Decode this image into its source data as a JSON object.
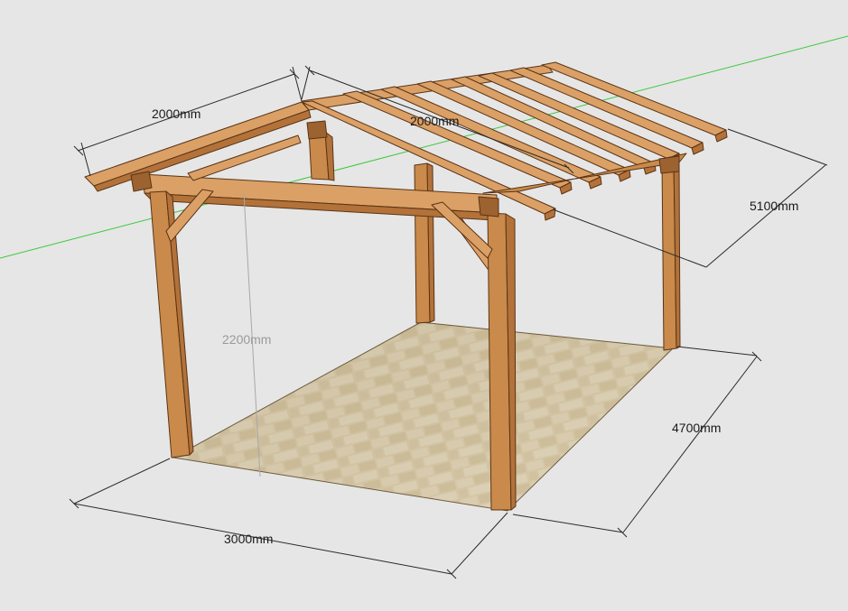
{
  "model": {
    "background": "#e6e6e6",
    "axis_color": "#3ec83e",
    "wood_color": "#c98a4b",
    "floor_color": "#d5c3a0"
  },
  "dimensions": {
    "ridge_length": "2000mm",
    "roof_slope": "2000mm",
    "depth_top": "5100mm",
    "post_height": "2200mm",
    "depth_bottom": "4700mm",
    "width_front": "3000mm"
  }
}
